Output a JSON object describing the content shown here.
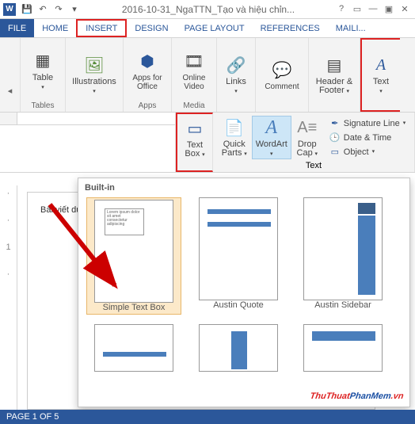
{
  "title": "2016-10-31_NgaTTN_Tạo và hiệu chỉn...",
  "tabs": {
    "file": "FILE",
    "home": "HOME",
    "insert": "INSERT",
    "design": "DESIGN",
    "pagelayout": "PAGE LAYOUT",
    "references": "REFERENCES",
    "mailings": "MAILI..."
  },
  "ribbon": {
    "tables": {
      "label": "Tables",
      "table": "Table"
    },
    "illus": {
      "btn": "Illustrations"
    },
    "apps": {
      "label": "Apps",
      "btn": "Apps for\nOffice"
    },
    "media": {
      "label": "Media",
      "btn": "Online\nVideo"
    },
    "links": {
      "btn": "Links"
    },
    "comments": {
      "btn": "Comment"
    },
    "hf": {
      "btn": "Header &\nFooter"
    },
    "text": {
      "btn": "Text"
    }
  },
  "ribbon2": {
    "textbox": "Text\nBox",
    "quickparts": "Quick\nParts",
    "wordart": "WordArt",
    "dropcap": "Drop\nCap",
    "sigline": "Signature Line",
    "datetime": "Date & Time",
    "object": "Object",
    "glabel": "Text"
  },
  "doc": {
    "snippet": "Bài viết dưới đây giới thiệu"
  },
  "gallery": {
    "header": "Built-in",
    "items": [
      "Simple Text Box",
      "Austin Quote",
      "Austin Sidebar"
    ]
  },
  "status": {
    "page": "PAGE 1 OF 5"
  },
  "watermark": {
    "a": "ThuThuat",
    "b": "PhanMem",
    "c": ".vn"
  }
}
